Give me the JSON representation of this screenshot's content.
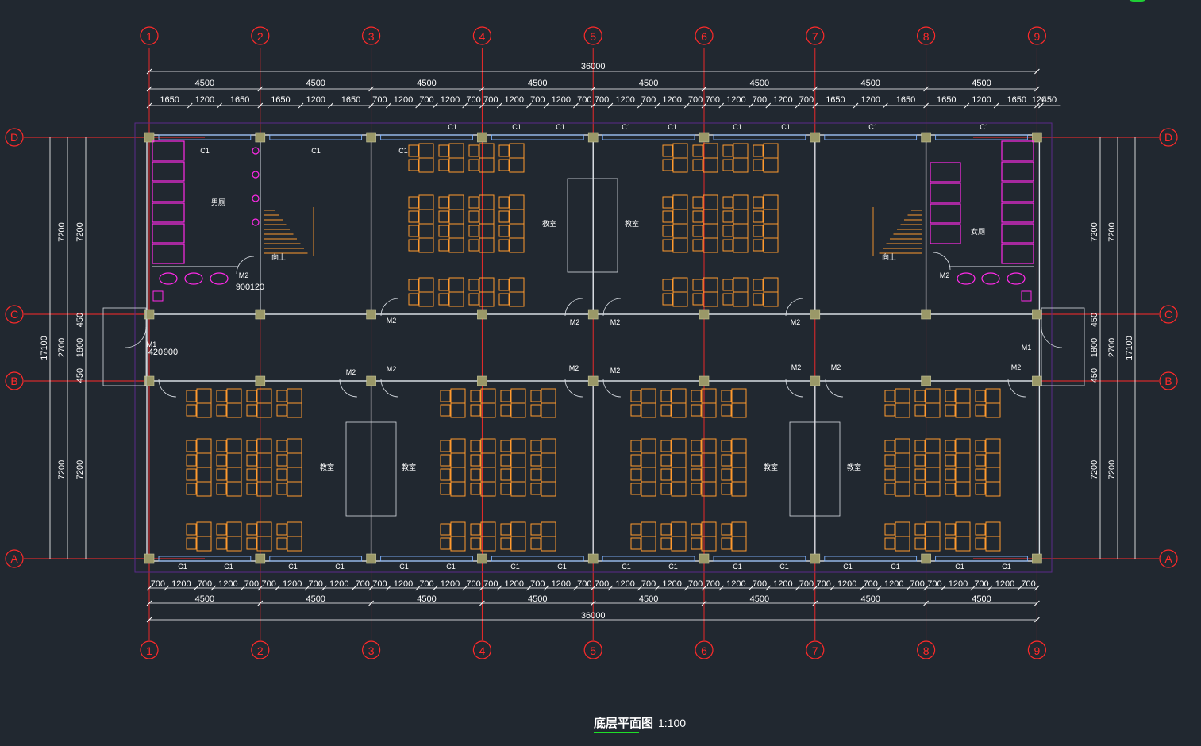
{
  "plan": {
    "title": "底层平面图",
    "scale": "1:100",
    "colors": {
      "background": "#212830",
      "axis": "#ff2a2a",
      "wall": "#d8dde3",
      "furniture": "#ff9a2e",
      "toilet": "#ff2ae8",
      "window": "#7fb3ff",
      "column": "#9a9868",
      "title_underline": "#1ee028"
    }
  },
  "axes": {
    "columns": [
      "1",
      "2",
      "3",
      "4",
      "5",
      "6",
      "7",
      "8",
      "9"
    ],
    "rows": [
      "D",
      "C",
      "B",
      "A"
    ]
  },
  "dimensions": {
    "top_total": "36000",
    "top_bays": [
      "4500",
      "4500",
      "4500",
      "4500",
      "4500",
      "4500",
      "4500",
      "4500"
    ],
    "top_detail": [
      "1650",
      "1200",
      "1650",
      "1650",
      "1200",
      "1650",
      "700",
      "1200",
      "700",
      "1200",
      "700",
      "700",
      "1200",
      "700",
      "1200",
      "700",
      "700",
      "1200",
      "700",
      "1200",
      "700",
      "700",
      "1200",
      "700",
      "1200",
      "700",
      "1650",
      "1200",
      "1650",
      "1650",
      "1200",
      "1650",
      "120",
      "450"
    ],
    "bottom_detail": [
      "700",
      "1200",
      "700",
      "1200",
      "700",
      "700",
      "1200",
      "700",
      "1200",
      "700",
      "700",
      "1200",
      "700",
      "1200",
      "700",
      "700",
      "1200",
      "700",
      "1200",
      "700",
      "700",
      "1200",
      "700",
      "1200",
      "700",
      "700",
      "1200",
      "700",
      "1200",
      "700",
      "700",
      "1200",
      "700",
      "1200",
      "700",
      "700",
      "1200",
      "700",
      "1200",
      "700"
    ],
    "bottom_bays": [
      "4500",
      "4500",
      "4500",
      "4500",
      "4500",
      "4500",
      "4500",
      "4500"
    ],
    "bottom_total": "36000",
    "left_outer": "17100",
    "left_inner": [
      "7200",
      "7200"
    ],
    "left_corridor": [
      "450",
      "2700",
      "1800",
      "450"
    ],
    "right_outer": "17100",
    "right_inner": [
      "7200",
      "7200"
    ],
    "right_corridor": [
      "450",
      "2700",
      "1800",
      "450"
    ],
    "door_width_label": "900",
    "door_offset_label": "120",
    "entry_labels": [
      "420",
      "900"
    ]
  },
  "labels": {
    "window": "C1",
    "door_main": "M1",
    "door_room": "M2",
    "toilet_left": "男厕",
    "toilet_right": "女厕",
    "stair": "向上",
    "classroom": "教室"
  }
}
